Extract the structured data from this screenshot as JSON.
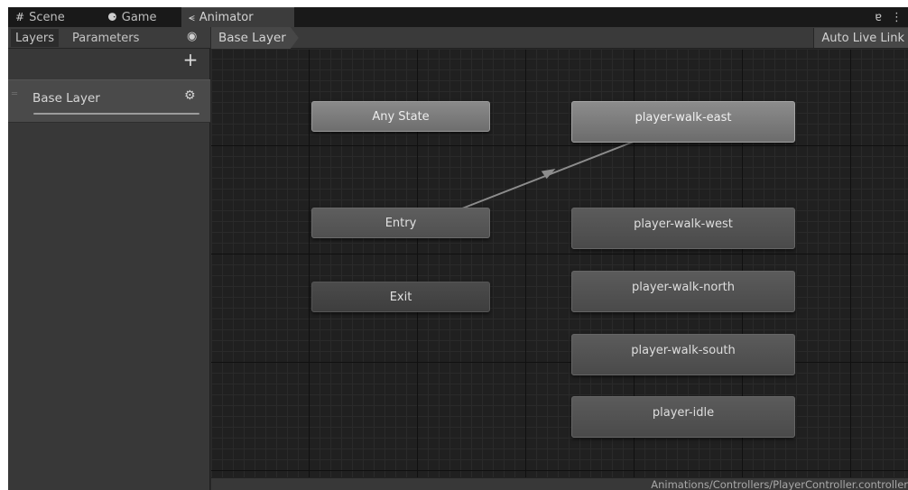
{
  "tabs": [
    {
      "label": "Scene",
      "icon": "#"
    },
    {
      "label": "Game",
      "icon": "⚈"
    },
    {
      "label": "Animator",
      "icon": "⪪"
    }
  ],
  "window_controls": {
    "lock_icon": "ɐ",
    "menu_icon": "⋮"
  },
  "left_panel": {
    "tabs": [
      "Layers",
      "Parameters"
    ],
    "eye_icon": "◉",
    "add_icon": "+",
    "layers": [
      {
        "name": "Base Layer",
        "gear_icon": "⚙"
      }
    ]
  },
  "graph": {
    "breadcrumb": "Base Layer",
    "auto_live_link": "Auto Live Link",
    "nodes": {
      "any_state": "Any State",
      "entry": "Entry",
      "exit": "Exit",
      "walk_east": "player-walk-east",
      "walk_west": "player-walk-west",
      "walk_north": "player-walk-north",
      "walk_south": "player-walk-south",
      "idle": "player-idle"
    }
  },
  "status": {
    "path": "Animations/Controllers/PlayerController.controller"
  },
  "colors": {
    "background": "#282828",
    "grid": "#202020",
    "default_state": "#7c7c7c",
    "transition": "#8c8c8c"
  }
}
